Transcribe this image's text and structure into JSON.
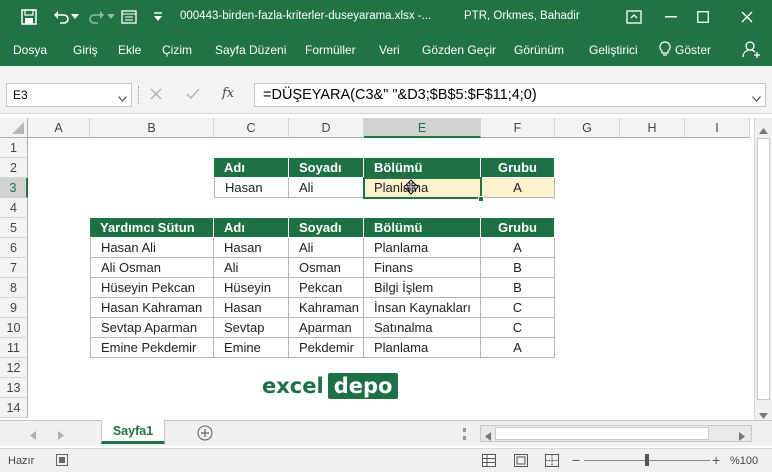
{
  "titlebar": {
    "file_name": "000443-birden-fazla-kriterler-duseyarama.xlsx  -...",
    "user": "PTR, Orkmes, Bahadir"
  },
  "ribbon_tabs": [
    "Dosya",
    "Giriş",
    "Ekle",
    "Çizim",
    "Sayfa Düzeni",
    "Formüller",
    "Veri",
    "Gözden Geçir",
    "Görünüm",
    "Geliştirici"
  ],
  "tell_me": "Göster",
  "formula_bar": {
    "name_box": "E3",
    "fx": "fx",
    "formula": "=DÜŞEYARA(C3&\" \"&D3;$B$5:$F$11;4;0)"
  },
  "columns": [
    "A",
    "B",
    "C",
    "D",
    "E",
    "F",
    "G",
    "H",
    "I"
  ],
  "rows": [
    "1",
    "2",
    "3",
    "4",
    "5",
    "6",
    "7",
    "8",
    "9",
    "10",
    "11",
    "12",
    "13",
    "14"
  ],
  "lookup_table": {
    "headers": [
      "Adı",
      "Soyadı",
      "Bölümü",
      "Grubu"
    ],
    "row": [
      "Hasan",
      "Ali",
      "Planlama",
      "A"
    ]
  },
  "data_table": {
    "headers": [
      "Yardımcı Sütun",
      "Adı",
      "Soyadı",
      "Bölümü",
      "Grubu"
    ],
    "rows": [
      [
        "Hasan Ali",
        "Hasan",
        "Ali",
        "Planlama",
        "A"
      ],
      [
        "Ali Osman",
        "Ali",
        "Osman",
        "Finans",
        "B"
      ],
      [
        "Hüseyin Pekcan",
        "Hüseyin",
        "Pekcan",
        "Bilgi İşlem",
        "B"
      ],
      [
        "Hasan Kahraman",
        "Hasan",
        "Kahraman",
        "İnsan Kaynakları",
        "C"
      ],
      [
        "Sevtap Aparman",
        "Sevtap",
        "Aparman",
        "Satınalma",
        "C"
      ],
      [
        "Emine Pekdemir",
        "Emine",
        "Pekdemir",
        "Planlama",
        "A"
      ]
    ]
  },
  "logo": {
    "part1": "excel",
    "part2": "depo"
  },
  "sheet_tab": "Sayfa1",
  "status": {
    "ready": "Hazır",
    "zoom": "%100"
  },
  "colors": {
    "excel_green": "#217346",
    "header_green": "#1e7145",
    "highlight": "#fff2cc",
    "logo_green": "#1e7145"
  },
  "icons": [
    "save-icon",
    "undo-icon",
    "redo-icon",
    "form-icon",
    "dropdown-icon",
    "ribbon-display-icon",
    "minimize-icon",
    "maximize-icon",
    "close-icon",
    "lightbulb-icon",
    "share-person-icon",
    "cancel-icon",
    "enter-check-icon",
    "add-sheet-icon",
    "normal-view-icon",
    "page-layout-icon",
    "page-break-icon"
  ]
}
